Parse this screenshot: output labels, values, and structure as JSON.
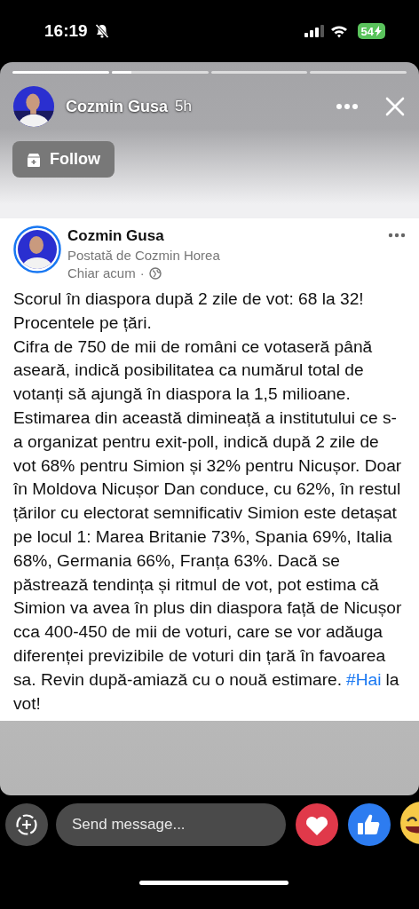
{
  "status_bar": {
    "time": "16:19",
    "battery": "54"
  },
  "story": {
    "progress": [
      {
        "level": 1
      },
      {
        "level": 0.2
      },
      {
        "level": 0
      },
      {
        "level": 0
      }
    ],
    "author": "Cozmin Gusa",
    "age": "5h",
    "follow_button": "Follow"
  },
  "post": {
    "author": "Cozmin Gusa",
    "posted_by": "Postată de Cozmin Horea",
    "time": "Chiar acum",
    "separator": "·",
    "paragraphs": [
      {
        "text": "Scorul în diaspora după 2 zile de vot: 68 la 32!"
      },
      {
        "text": "Procentele pe țări."
      },
      {
        "text": "Cifra de 750 de mii de români ce votaseră până aseară, indică posibilitatea ca numărul total de votanți să ajungă în diaspora la 1,5 milioane. Estimarea din această dimineață a institutului ce s-a organizat pentru exit-poll, indică după 2 zile de vot 68% pentru Simion și 32% pentru Nicușor. Doar în Moldova Nicușor Dan conduce, cu 62%, în restul țărilor cu electorat semnificativ Simion este detașat pe locul 1: Marea Britanie 73%, Spania 69%, Italia 68%, Germania 66%, Franța 63%. Dacă se păstrează tendința și ritmul de vot, pot estima că Simion va avea în plus din diaspora față de Nicușor cca 400-450 de mii de voturi, care se vor adăuga diferenței previzibile de voturi din țară în favoarea sa. Revin după-amiază cu o nouă estimare.",
        "hashtag": "#Hai",
        "after": "la vot!"
      }
    ]
  },
  "message_bar": {
    "placeholder": "Send message..."
  }
}
